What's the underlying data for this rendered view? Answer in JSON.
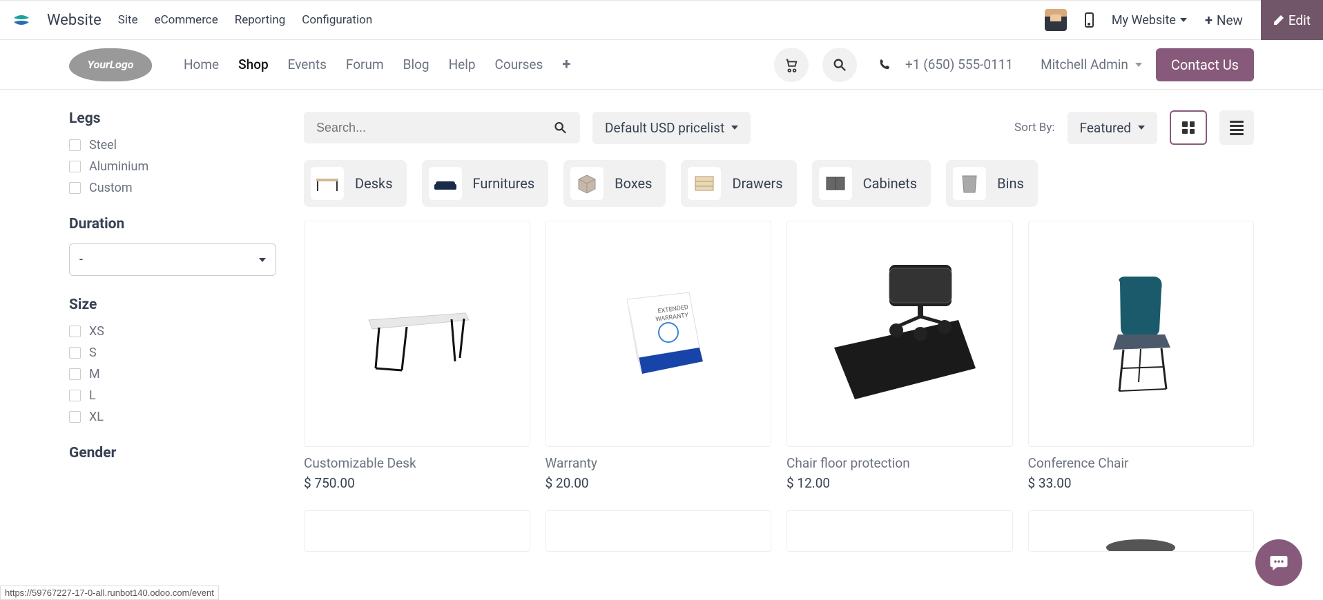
{
  "topbar": {
    "title": "Website",
    "menu": [
      "Site",
      "eCommerce",
      "Reporting",
      "Configuration"
    ],
    "my_website": "My Website",
    "new_label": "New",
    "edit_label": "Edit"
  },
  "header": {
    "logo_text": "YourLogo",
    "nav": [
      "Home",
      "Shop",
      "Events",
      "Forum",
      "Blog",
      "Help",
      "Courses"
    ],
    "active_nav_index": 1,
    "phone": "+1 (650) 555-0111",
    "user": "Mitchell Admin",
    "contact": "Contact Us"
  },
  "sidebar": {
    "filters": [
      {
        "title": "Legs",
        "type": "checkbox",
        "options": [
          "Steel",
          "Aluminium",
          "Custom"
        ]
      },
      {
        "title": "Duration",
        "type": "select",
        "value": "-"
      },
      {
        "title": "Size",
        "type": "checkbox",
        "options": [
          "XS",
          "S",
          "M",
          "L",
          "XL"
        ]
      },
      {
        "title": "Gender",
        "type": "checkbox",
        "options": []
      }
    ]
  },
  "controls": {
    "search_placeholder": "Search...",
    "pricelist": "Default USD pricelist",
    "sort_label": "Sort By:",
    "sort_value": "Featured"
  },
  "categories": [
    "Desks",
    "Furnitures",
    "Boxes",
    "Drawers",
    "Cabinets",
    "Bins"
  ],
  "products": [
    {
      "name": "Customizable Desk",
      "price": "$ 750.00"
    },
    {
      "name": "Warranty",
      "price": "$ 20.00"
    },
    {
      "name": "Chair floor protection",
      "price": "$ 12.00"
    },
    {
      "name": "Conference Chair",
      "price": "$ 33.00"
    }
  ],
  "status_url": "https://59767227-17-0-all.runbot140.odoo.com/event",
  "accent_color": "#875A7B"
}
